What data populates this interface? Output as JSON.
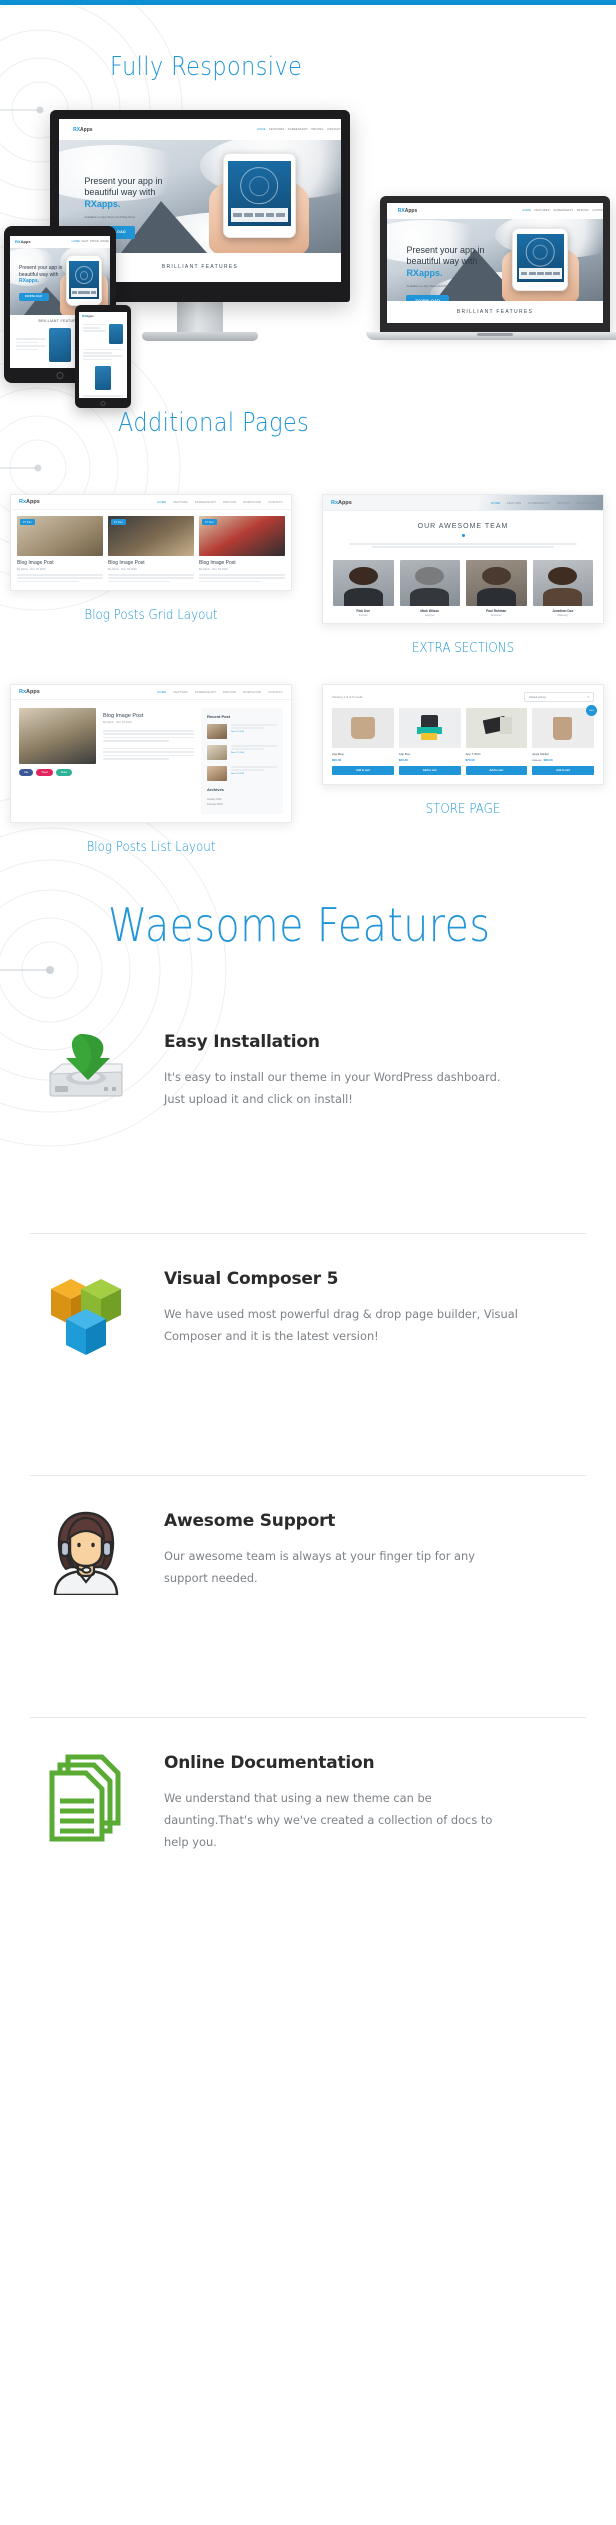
{
  "theme": {
    "accent": "#2096d8",
    "topbar_color": "#0d8fd4",
    "heading_color": "#2096d8",
    "feature_title_color": "#2b2b2b",
    "feature_desc_color": "#7d8287",
    "green": "#4caf50",
    "orange": "#f0a41e"
  },
  "sections": {
    "responsive_heading": "Fully Responsive",
    "additional_heading": "Additional Pages",
    "features_heading": "Waesome Features"
  },
  "hero_site": {
    "logo_rx": "RX",
    "logo_apps": "Apps",
    "menu": [
      "HOME",
      "FEATURES",
      "SCREENSHOT",
      "PRICING",
      "CONTACT"
    ],
    "title_line1": "Present your app in",
    "title_line2": "beautiful way with",
    "title_brand": "RXapps.",
    "subtitle": "Available on App Store And Play Store",
    "download_label": "DOWNLOAD",
    "section_title": "BRILLIANT FEATURES"
  },
  "thumbnails": [
    {
      "caption": "Blog Posts Grid Layout",
      "nav": {
        "logo_rx": "Rx",
        "logo_apps": "Apps",
        "menu": [
          "HOME",
          "FEATURE",
          "SCREENSHOT",
          "PRICING",
          "DOWNLOAD",
          "CONTACT"
        ]
      },
      "posts": [
        {
          "badge": "07 Nov",
          "title": "Blog Image Post",
          "meta": "By Admin · Nov 7th 2016"
        },
        {
          "badge": "07 Nov",
          "title": "Blog Image Post",
          "meta": "By Admin · Nov 7th 2016"
        },
        {
          "badge": "07 Nov",
          "title": "Blog Image Post",
          "meta": "By Admin · Nov 7th 2016"
        }
      ]
    },
    {
      "caption": "EXTRA SECTIONS",
      "nav": {
        "logo_rx": "Rx",
        "logo_apps": "Apps",
        "menu": [
          "HOME",
          "FEATURE",
          "SCREENSHOT",
          "PRICING",
          "DOWNLOAD"
        ]
      },
      "team_title": "OUR AWESOME TEAM",
      "members": [
        {
          "name": "Rick Doe",
          "role": "Founder"
        },
        {
          "name": "Mark Wilson",
          "role": "Designer"
        },
        {
          "name": "Paul Rahman",
          "role": "Developer"
        },
        {
          "name": "Jonathon Doe",
          "role": "Marketing"
        }
      ]
    },
    {
      "caption": "Blog Posts List Layout",
      "nav": {
        "logo_rx": "Rx",
        "logo_apps": "Apps",
        "menu": [
          "HOME",
          "FEATURE",
          "SCREENSHOT",
          "PRICING",
          "DOWNLOAD",
          "CONTACT"
        ]
      },
      "post_title": "Blog Image Post",
      "post_meta": "By Admin · Nov 7th 2016",
      "sidebar_title": "Recent Post",
      "recent": [
        {
          "date": "Nov 07, 2016"
        },
        {
          "date": "Nov 07, 2016"
        },
        {
          "date": "Nov 07, 2016"
        }
      ],
      "archive_title": "Archives",
      "archive_items": [
        "January 2016",
        "February 2016"
      ],
      "share_pills": [
        "Like",
        "Tweet",
        "Share"
      ]
    },
    {
      "caption": "STORE PAGE",
      "results_text": "Showing 1–8 of 9 results",
      "sort_label": "Default sorting",
      "products": [
        {
          "name": "App Bag",
          "price": "$90.00",
          "old_price": "",
          "button": "Add to cart",
          "sale": false
        },
        {
          "name": "App Box",
          "price": "$20.00",
          "old_price": "",
          "button": "Add to cart",
          "sale": false
        },
        {
          "name": "App T-Shirt",
          "price": "$70.00",
          "old_price": "",
          "button": "Add to cart",
          "sale": false
        },
        {
          "name": "Apps Sticker",
          "price": "$60.00",
          "old_price": "$80.00",
          "button": "Add to cart",
          "sale": true,
          "sale_label": "Sale!"
        }
      ]
    }
  ],
  "features": [
    {
      "icon": "disk-download-icon",
      "title": "Easy Installation",
      "description": "It's easy to install our theme in your WordPress dashboard. Just upload it and click on install!"
    },
    {
      "icon": "visual-composer-cube-icon",
      "title": "Visual Composer 5",
      "description": "We have used most powerful drag & drop page builder, Visual Composer and it is the latest version!"
    },
    {
      "icon": "support-agent-icon",
      "title": "Awesome Support",
      "description": "Our awesome team is always at your finger tip for any support needed."
    },
    {
      "icon": "documents-stack-icon",
      "title": "Online Documentation",
      "description": "We understand that using a new theme can be daunting.That's why we've created a collection of docs to help you."
    }
  ]
}
